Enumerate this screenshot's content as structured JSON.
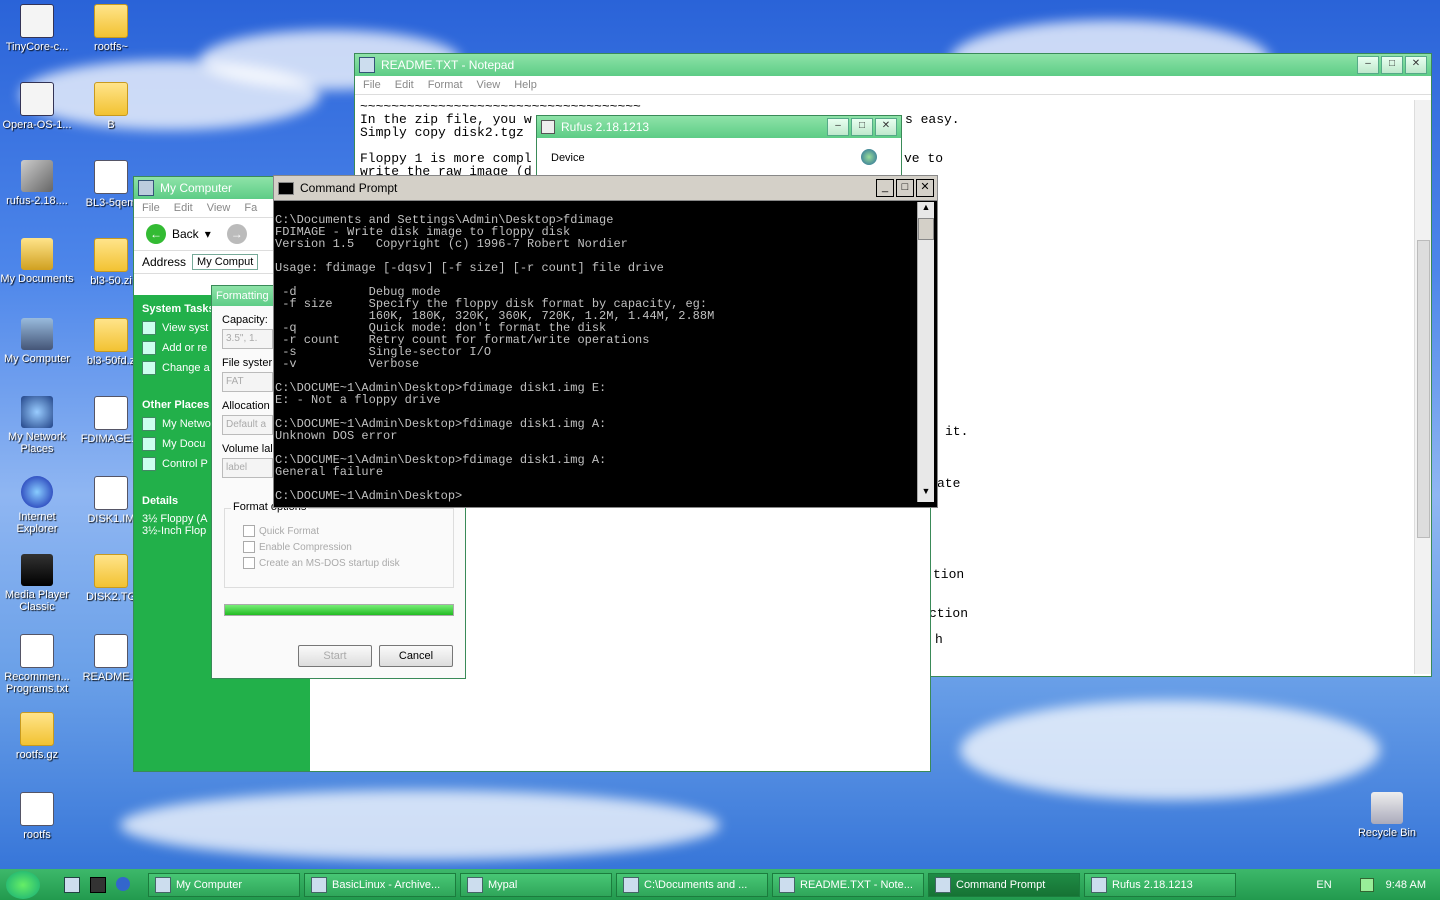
{
  "desktop": {
    "icons": [
      {
        "label": "TinyCore-c...",
        "icon": "iso-icon"
      },
      {
        "label": "rootfs~",
        "icon": "folder-icon"
      },
      {
        "label": "Opera-OS-1...",
        "icon": "iso-icon"
      },
      {
        "label": "B",
        "icon": "folder-icon"
      },
      {
        "label": "rufus-2.18....",
        "icon": "usb-icon"
      },
      {
        "label": "BL3-5qem",
        "icon": "doc-icon"
      },
      {
        "label": "My Documents",
        "icon": "my-documents-icon"
      },
      {
        "label": "bl3-50.zi",
        "icon": "zip-folder-icon"
      },
      {
        "label": "My Computer",
        "icon": "computer-icon"
      },
      {
        "label": "bl3-50fd.z",
        "icon": "zip-folder-icon"
      },
      {
        "label": "My Network Places",
        "icon": "network-icon"
      },
      {
        "label": "FDIMAGE.E",
        "icon": "window-icon"
      },
      {
        "label": "Internet Explorer",
        "icon": "ie-icon"
      },
      {
        "label": "DISK1.IM",
        "icon": "doc-icon"
      },
      {
        "label": "Media Player Classic",
        "icon": "media-player-icon"
      },
      {
        "label": "DISK2.TG",
        "icon": "zip-folder-icon"
      },
      {
        "label": "Recommen... Programs.txt",
        "icon": "doc-icon"
      },
      {
        "label": "README.T",
        "icon": "doc-icon"
      },
      {
        "label": "rootfs.gz",
        "icon": "zip-folder-icon"
      },
      {
        "label": "rootfs",
        "icon": "doc-icon"
      },
      {
        "label": "Recycle Bin",
        "icon": "recycle-bin-icon"
      }
    ]
  },
  "notepad": {
    "title": "README.TXT - Notepad",
    "menu": [
      "File",
      "Edit",
      "Format",
      "View",
      "Help"
    ],
    "lines_left": "~~~~~~~~~~~~~~~~~~~~~~~~~~~~~~~~~~~~\nIn the zip file, you w\nSimply copy disk2.tgz\n\nFloppy 1 is more compl\nwrite the raw image (d",
    "frag_right": [
      "s easy.",
      "ve to",
      "it.",
      "ate",
      "tion",
      "ction",
      "h"
    ]
  },
  "rufus": {
    "title": "Rufus 2.18.1213",
    "device_label": "Device"
  },
  "my_computer": {
    "title": "My Computer",
    "menu": [
      "File",
      "Edit",
      "View",
      "Fa"
    ],
    "back_label": "Back",
    "address_label": "Address",
    "address_value": "My Comput",
    "system_tasks": {
      "heading": "System Tasks",
      "items": [
        "View syst",
        "Add or re",
        "Change a"
      ]
    },
    "other_places": {
      "heading": "Other Places",
      "items": [
        "My Netwo",
        "My Docu",
        "Control P"
      ]
    },
    "details": {
      "heading": "Details",
      "line1": "3½ Floppy (A",
      "line2": "3½-Inch Flop"
    }
  },
  "format_dialog": {
    "title": "Formatting",
    "capacity_label": "Capacity:",
    "capacity_value": "3.5\", 1.",
    "filesystem_label": "File syster",
    "filesystem_value": "FAT",
    "allocation_label": "Allocation",
    "allocation_value": "Default a",
    "volume_label": "Volume lal",
    "volume_value": "label",
    "options_heading": "Format options",
    "options": [
      "Quick Format",
      "Enable Compression",
      "Create an MS-DOS startup disk"
    ],
    "progress": 1.0,
    "start_label": "Start",
    "cancel_label": "Cancel"
  },
  "cmd": {
    "title": "Command Prompt",
    "output": "C:\\Documents and Settings\\Admin\\Desktop>fdimage\nFDIMAGE - Write disk image to floppy disk\nVersion 1.5   Copyright (c) 1996-7 Robert Nordier\n\nUsage: fdimage [-dqsv] [-f size] [-r count] file drive\n\n -d          Debug mode\n -f size     Specify the floppy disk format by capacity, eg:\n             160K, 180K, 320K, 360K, 720K, 1.2M, 1.44M, 2.88M\n -q          Quick mode: don't format the disk\n -r count    Retry count for format/write operations\n -s          Single-sector I/O\n -v          Verbose\n\nC:\\DOCUME~1\\Admin\\Desktop>fdimage disk1.img E:\nE: - Not a floppy drive\n\nC:\\DOCUME~1\\Admin\\Desktop>fdimage disk1.img A:\nUnknown DOS error\n\nC:\\DOCUME~1\\Admin\\Desktop>fdimage disk1.img A:\nGeneral failure\n\nC:\\DOCUME~1\\Admin\\Desktop>"
  },
  "taskbar": {
    "tasks": [
      {
        "label": "My Computer",
        "active": false
      },
      {
        "label": "BasicLinux - Archive...",
        "active": false
      },
      {
        "label": "Mypal",
        "active": false
      },
      {
        "label": "C:\\Documents and ...",
        "active": false
      },
      {
        "label": "README.TXT - Note...",
        "active": false
      },
      {
        "label": "Command Prompt",
        "active": true
      },
      {
        "label": "Rufus 2.18.1213",
        "active": false
      }
    ],
    "language": "EN",
    "clock": "9:48 AM"
  }
}
